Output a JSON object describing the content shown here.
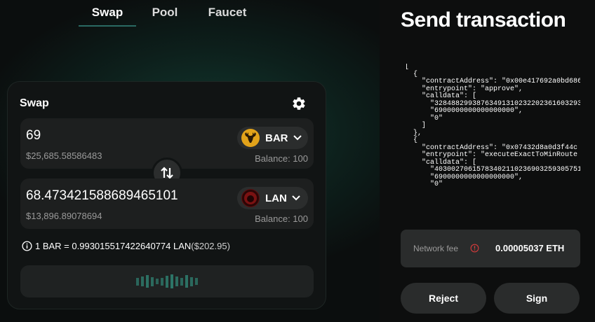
{
  "nav": {
    "tabs": [
      {
        "label": "Swap"
      },
      {
        "label": "Pool"
      },
      {
        "label": "Faucet"
      }
    ]
  },
  "swap": {
    "title": "Swap",
    "from": {
      "amount": "69",
      "usd": "$25,685.58586483",
      "token": "BAR",
      "balance": "Balance: 100"
    },
    "to": {
      "amount": "68.473421588689465101",
      "usd": "$13,896.89078694",
      "token": "LAN",
      "balance": "Balance: 100"
    },
    "rate": {
      "text": "1 BAR = 0.993015517422640774 LAN",
      "usd": "($202.95)"
    }
  },
  "transaction": {
    "title": "Send transaction",
    "json": "[\n  {\n    \"contractAddress\": \"0x00e417692a0bd686\n    \"entrypoint\": \"approve\",\n    \"calldata\": [\n      \"32848829938763491310232202361603293\n      \"6900000000000000000\",\n      \"0\"\n    ]\n  },\n  {\n    \"contractAddress\": \"0x07432d8a0d3f44c\n    \"entrypoint\": \"executeExactToMinRoute\n    \"calldata\": [\n      \"40300270615783402110236903259305751\n      \"6900000000000000000\",\n      \"0\"",
    "fee_label": "Network fee",
    "fee_value": "0.00005037 ETH",
    "reject_label": "Reject",
    "sign_label": "Sign"
  },
  "colors": {
    "accent": "#2a6a63",
    "loader": "#2e7a6b",
    "bar_token": "#e2a31a",
    "fee_info": "#d23b3b"
  },
  "icons": {
    "settings": "gear-icon",
    "switch": "swap-arrows-icon",
    "info": "info-icon",
    "dropdown": "chevron-down-icon"
  },
  "loader_levels": [
    0.45,
    0.6,
    0.75,
    0.55,
    0.35,
    0.45,
    0.7,
    0.85,
    0.6,
    0.45,
    0.75,
    0.55,
    0.4
  ]
}
